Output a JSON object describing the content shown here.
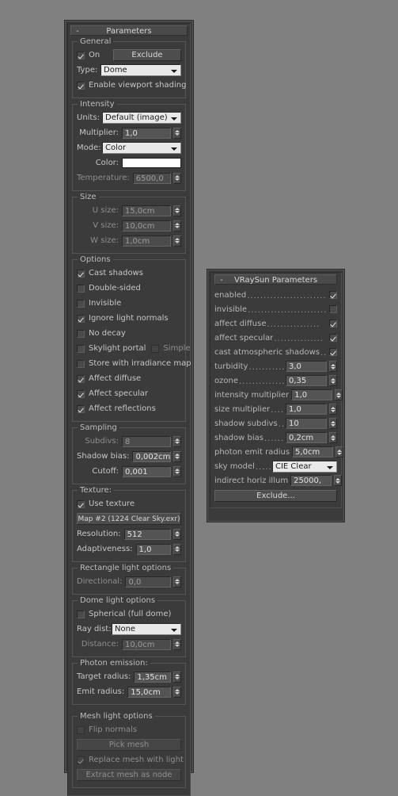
{
  "light_panel": {
    "title": "Parameters",
    "collapse": "-",
    "general": {
      "legend": "General",
      "on_label": "On",
      "on_checked": true,
      "exclude_button": "Exclude",
      "type_label": "Type:",
      "type_value": "Dome",
      "viewport_shading_label": "Enable viewport shading",
      "viewport_shading_checked": true
    },
    "intensity": {
      "legend": "Intensity",
      "units_label": "Units:",
      "units_value": "Default (image)",
      "multiplier_label": "Multiplier:",
      "multiplier_value": "1,0",
      "mode_label": "Mode:",
      "mode_value": "Color",
      "color_label": "Color:",
      "color_value": "#ffffff",
      "temperature_label": "Temperature:",
      "temperature_value": "6500,0"
    },
    "size": {
      "legend": "Size",
      "u_label": "U size:",
      "u_value": "15,0cm",
      "v_label": "V size:",
      "v_value": "10,0cm",
      "w_label": "W size:",
      "w_value": "1,0cm"
    },
    "options": {
      "legend": "Options",
      "items": [
        {
          "label": "Cast shadows",
          "checked": true
        },
        {
          "label": "Double-sided",
          "checked": false
        },
        {
          "label": "Invisible",
          "checked": false
        },
        {
          "label": "Ignore light normals",
          "checked": true
        },
        {
          "label": "No decay",
          "checked": false
        },
        {
          "label": "Skylight portal",
          "checked": false
        },
        {
          "label": "Store with irradiance map",
          "checked": false
        },
        {
          "label": "Affect diffuse",
          "checked": true
        },
        {
          "label": "Affect specular",
          "checked": true
        },
        {
          "label": "Affect reflections",
          "checked": true
        }
      ],
      "simple_label": "Simple",
      "simple_checked": false
    },
    "sampling": {
      "legend": "Sampling",
      "subdivs_label": "Subdivs:",
      "subdivs_value": "8",
      "shadow_bias_label": "Shadow bias:",
      "shadow_bias_value": "0,002cm",
      "cutoff_label": "Cutoff:",
      "cutoff_value": "0,001"
    },
    "texture": {
      "legend": "Texture:",
      "use_texture_label": "Use texture",
      "use_texture_checked": true,
      "map_button": "Map #2 (1224 Clear Sky.exr)",
      "resolution_label": "Resolution:",
      "resolution_value": "512",
      "adaptiveness_label": "Adaptiveness:",
      "adaptiveness_value": "1,0"
    },
    "rectangle": {
      "legend": "Rectangle light options",
      "directional_label": "Directional:",
      "directional_value": "0,0"
    },
    "dome": {
      "legend": "Dome light options",
      "spherical_label": "Spherical (full dome)",
      "spherical_checked": false,
      "raydist_label": "Ray dist:",
      "raydist_value": "None",
      "distance_label": "Distance:",
      "distance_value": "10,0cm"
    },
    "photon": {
      "legend": "Photon emission:",
      "target_radius_label": "Target radius:",
      "target_radius_value": "1,35cm",
      "emit_radius_label": "Emit radius:",
      "emit_radius_value": "15,0cm"
    },
    "mesh": {
      "legend": "Mesh light options",
      "flip_normals_label": "Flip normals",
      "flip_normals_checked": false,
      "pick_mesh_button": "Pick mesh",
      "replace_label": "Replace mesh with light",
      "replace_checked": true,
      "extract_button": "Extract mesh as node"
    }
  },
  "sun_panel": {
    "title": "VRaySun Parameters",
    "collapse": "-",
    "checks": [
      {
        "label": "enabled",
        "leader": "........................",
        "checked": true
      },
      {
        "label": "invisible",
        "leader": "........................",
        "checked": false
      },
      {
        "label": "affect diffuse",
        "leader": "................",
        "checked": true
      },
      {
        "label": "affect specular",
        "leader": "...............",
        "checked": true
      },
      {
        "label": "cast atmospheric shadows",
        "leader": "..",
        "checked": true
      }
    ],
    "numbers": [
      {
        "label": "turbidity",
        "leader": ".............",
        "value": "3,0"
      },
      {
        "label": "ozone",
        "leader": "................",
        "value": "0,35"
      },
      {
        "label": "intensity multiplier",
        "leader": "..",
        "value": "1,0"
      },
      {
        "label": "size multiplier",
        "leader": "........",
        "value": "1,0"
      },
      {
        "label": "shadow subdivs",
        "leader": "....",
        "value": "10"
      },
      {
        "label": "shadow bias",
        "leader": ".........",
        "value": "0,2cm"
      },
      {
        "label": "photon emit radius",
        "leader": ".",
        "value": "5,0cm"
      }
    ],
    "sky_model_label": "sky model",
    "sky_model_leader": ".....",
    "sky_model_value": "CIE Clear",
    "indirect_label": "indirect horiz illum",
    "indirect_leader": "..",
    "indirect_value": "25000,",
    "exclude_button": "Exclude..."
  }
}
